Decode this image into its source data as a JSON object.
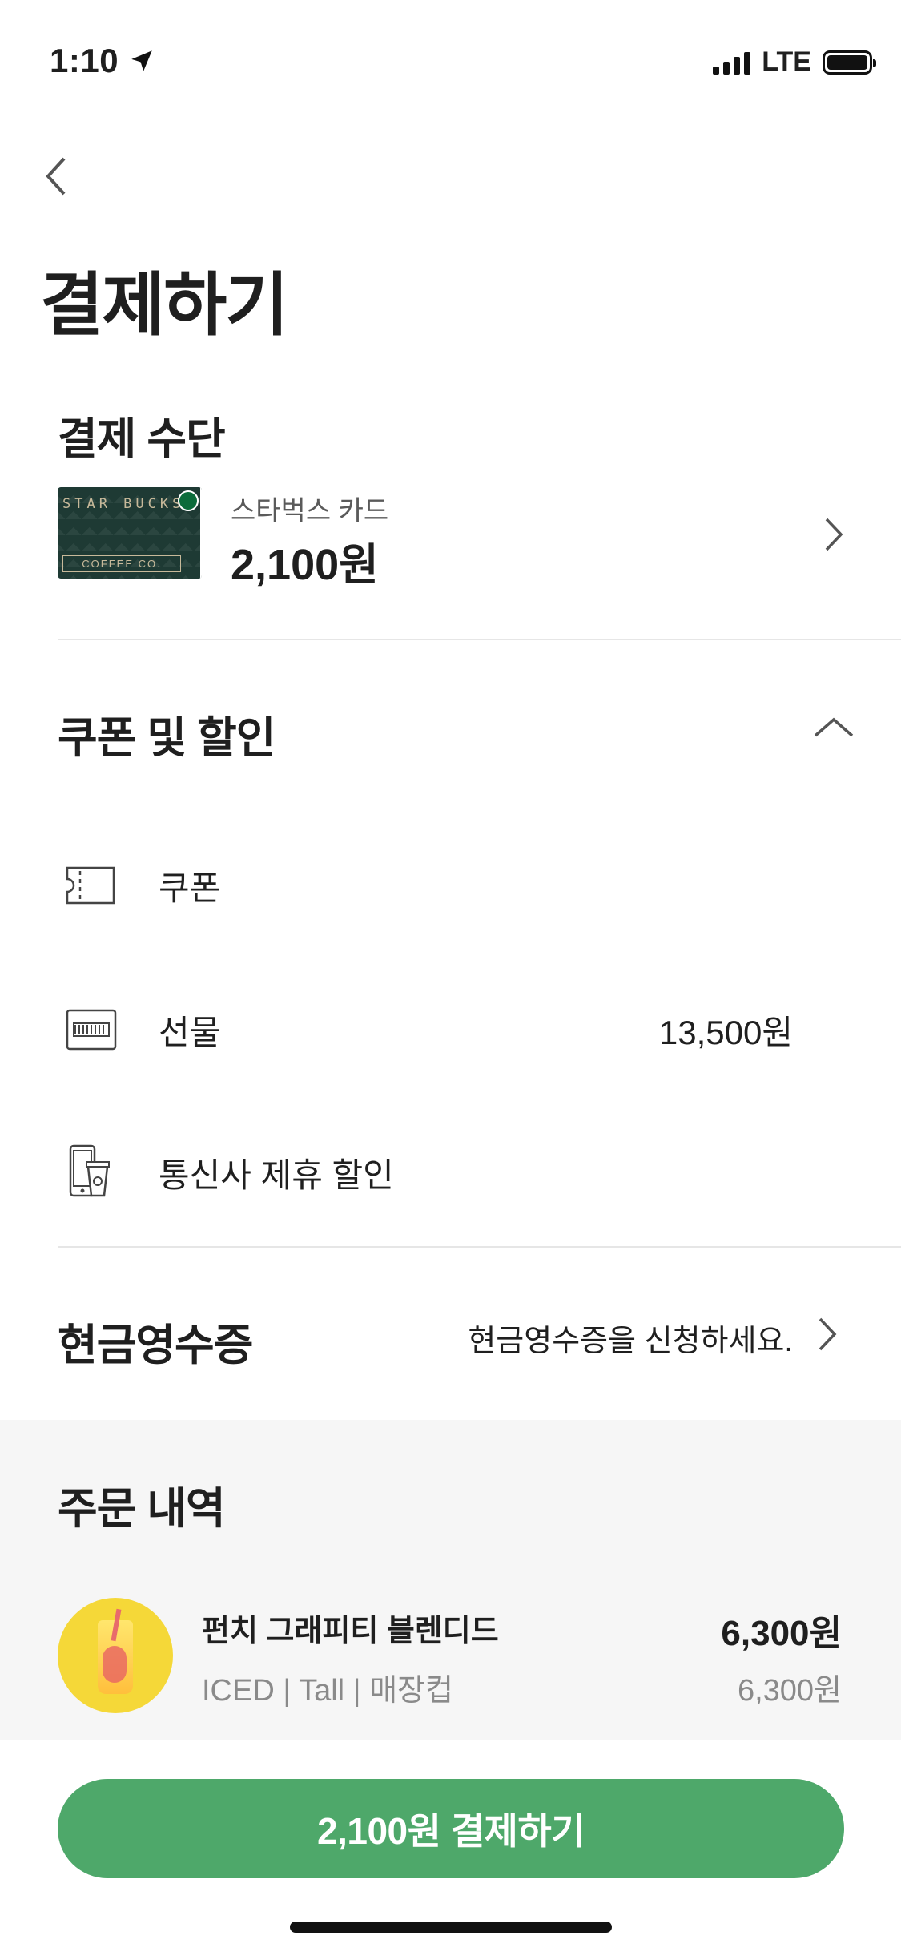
{
  "status_bar": {
    "time": "1:10",
    "network": "LTE"
  },
  "page": {
    "title": "결제하기"
  },
  "payment_method": {
    "section_title": "결제 수단",
    "card_name": "스타벅스 카드",
    "card_balance": "2,100원",
    "card_art_text": "STAR BUCKS",
    "card_art_sub": "COFFEE CO."
  },
  "coupons_discounts": {
    "section_title": "쿠폰 및 할인",
    "items": [
      {
        "label": "쿠폰",
        "value": "",
        "icon": "ticket-icon"
      },
      {
        "label": "선물",
        "value": "13,500원",
        "icon": "gift-card-icon"
      },
      {
        "label": "통신사 제휴 할인",
        "value": "",
        "icon": "phone-cup-icon"
      }
    ]
  },
  "cash_receipt": {
    "section_title": "현금영수증",
    "hint": "현금영수증을 신청하세요."
  },
  "order_history": {
    "section_title": "주문 내역",
    "items": [
      {
        "name": "펀치 그래피티 블렌디드",
        "options": "ICED | Tall | 매장컵",
        "price": "6,300원",
        "unit_price": "6,300원"
      }
    ]
  },
  "footer": {
    "pay_button_label": "2,100원 결제하기"
  },
  "colors": {
    "accent_green": "#4ea86a",
    "card_green": "#1e3a34"
  }
}
